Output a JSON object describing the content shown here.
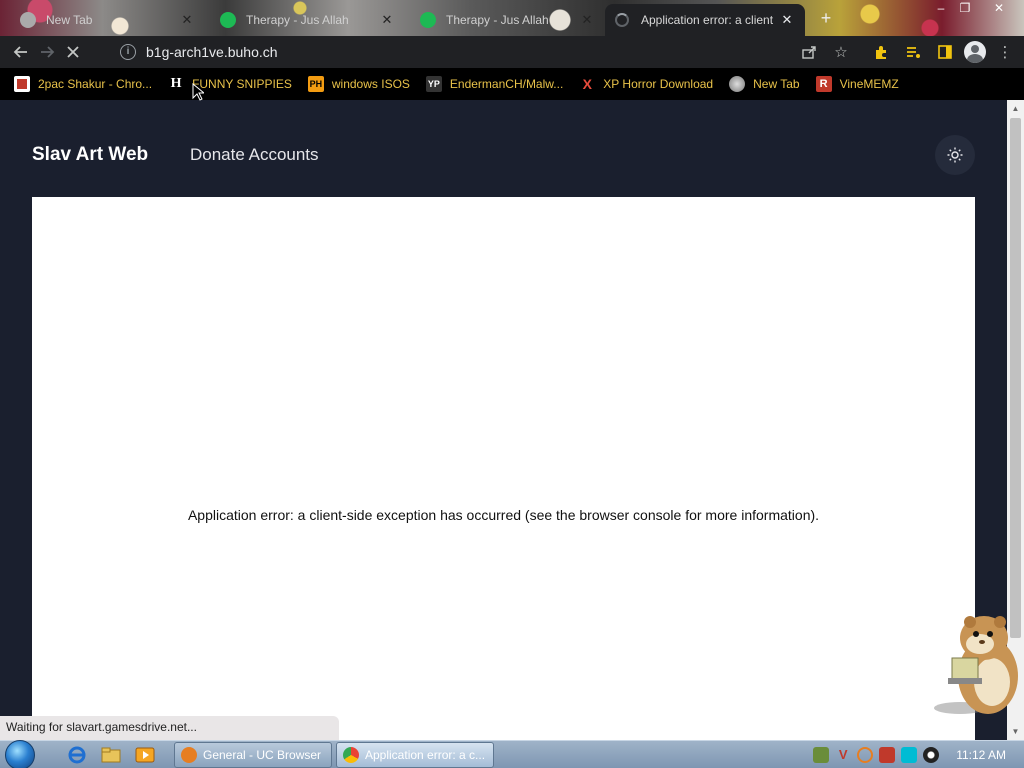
{
  "tabs": [
    {
      "title": "New Tab",
      "favicon": "chrome-icon",
      "active": false
    },
    {
      "title": "Therapy - Jus Allah",
      "favicon": "spotify-icon",
      "active": false
    },
    {
      "title": "Therapy - Jus Allah",
      "favicon": "spotify-icon",
      "active": false
    },
    {
      "title": "Application error: a client",
      "favicon": "loading-spinner-icon",
      "active": true
    }
  ],
  "toolbar": {
    "url": "b1g-arch1ve.buho.ch"
  },
  "bookmarks": [
    {
      "label": "2pac Shakur - Chro...",
      "icon": "bookmark-folder-icon"
    },
    {
      "label": "FUNNY SNIPPIES",
      "icon": "H"
    },
    {
      "label": "windows ISOS",
      "icon": "PH"
    },
    {
      "label": "EndermanCH/Malw...",
      "icon": "YP"
    },
    {
      "label": "XP Horror Download",
      "icon": "X"
    },
    {
      "label": "New Tab",
      "icon": "globe-icon"
    },
    {
      "label": "VineMEMZ",
      "icon": "R"
    }
  ],
  "page": {
    "brand": "Slav Art Web",
    "nav_link": "Donate Accounts",
    "error_message": "Application error: a client-side exception has occurred (see the browser console for more information)."
  },
  "status": {
    "text": "Waiting for slavart.gamesdrive.net..."
  },
  "taskbar": {
    "buttons": [
      {
        "label": "General - UC Browser",
        "active": false
      },
      {
        "label": "Application error: a c...",
        "active": true
      }
    ],
    "clock": "11:12 AM"
  },
  "colors": {
    "page_bg": "#1a1f2e",
    "bookmark_text": "#e8c24a",
    "chrome_toolbar": "#202124"
  }
}
